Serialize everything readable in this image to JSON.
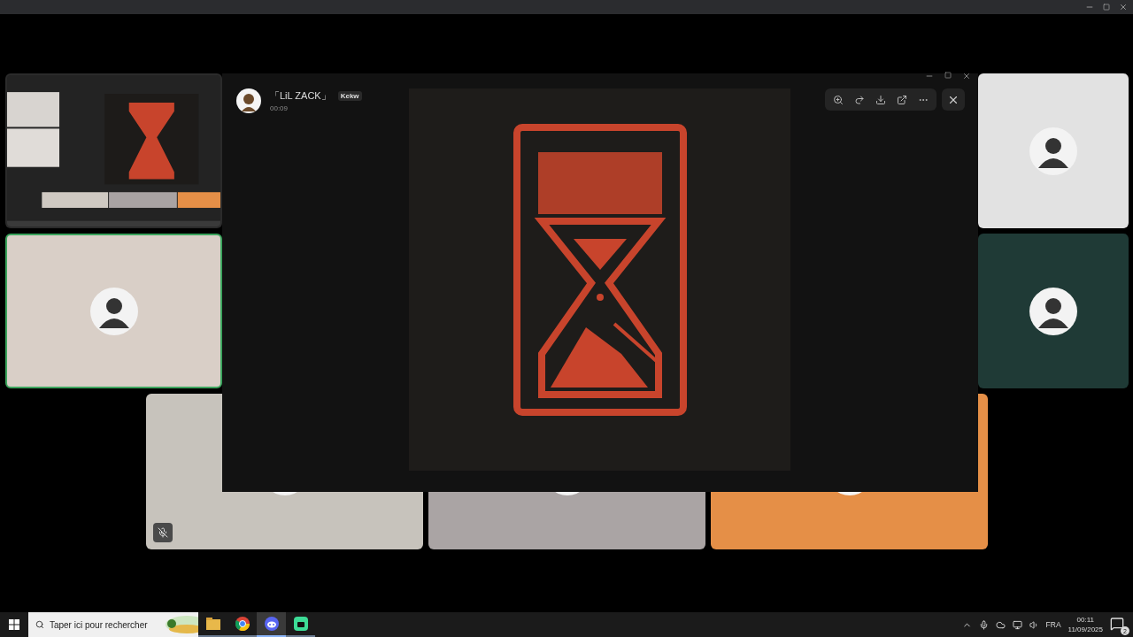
{
  "tiles": [
    {
      "kind": "screen",
      "color": "#2b2b2b",
      "speaking": false,
      "muted": false
    },
    {
      "kind": "avatar",
      "color": "#e2e2e2",
      "speaking": false,
      "muted": false
    },
    {
      "kind": "avatar",
      "color": "#d9cfc7",
      "speaking": true,
      "muted": false
    },
    {
      "kind": "avatar",
      "color": "#1f3a36",
      "speaking": false,
      "muted": false
    },
    {
      "kind": "avatar",
      "color": "#c7c3bc",
      "speaking": false,
      "muted": true
    },
    {
      "kind": "avatar",
      "color": "#aaa4a4",
      "speaking": false,
      "muted": false
    },
    {
      "kind": "avatar",
      "color": "#e58f47",
      "speaking": false,
      "muted": false
    }
  ],
  "viewer": {
    "author": "「LiL ZACK」",
    "badge": "Kekw",
    "time": "00:09"
  },
  "taskbar": {
    "search": {
      "placeholder": "Taper ici pour rechercher"
    },
    "apps": [
      {
        "kind": "files",
        "selected": false
      },
      {
        "kind": "browser",
        "selected": false
      },
      {
        "kind": "chat",
        "selected": true
      },
      {
        "kind": "game",
        "selected": false
      }
    ],
    "language": "FRA",
    "time": "00:11",
    "date": "11/09/2025",
    "notifications": "2"
  }
}
